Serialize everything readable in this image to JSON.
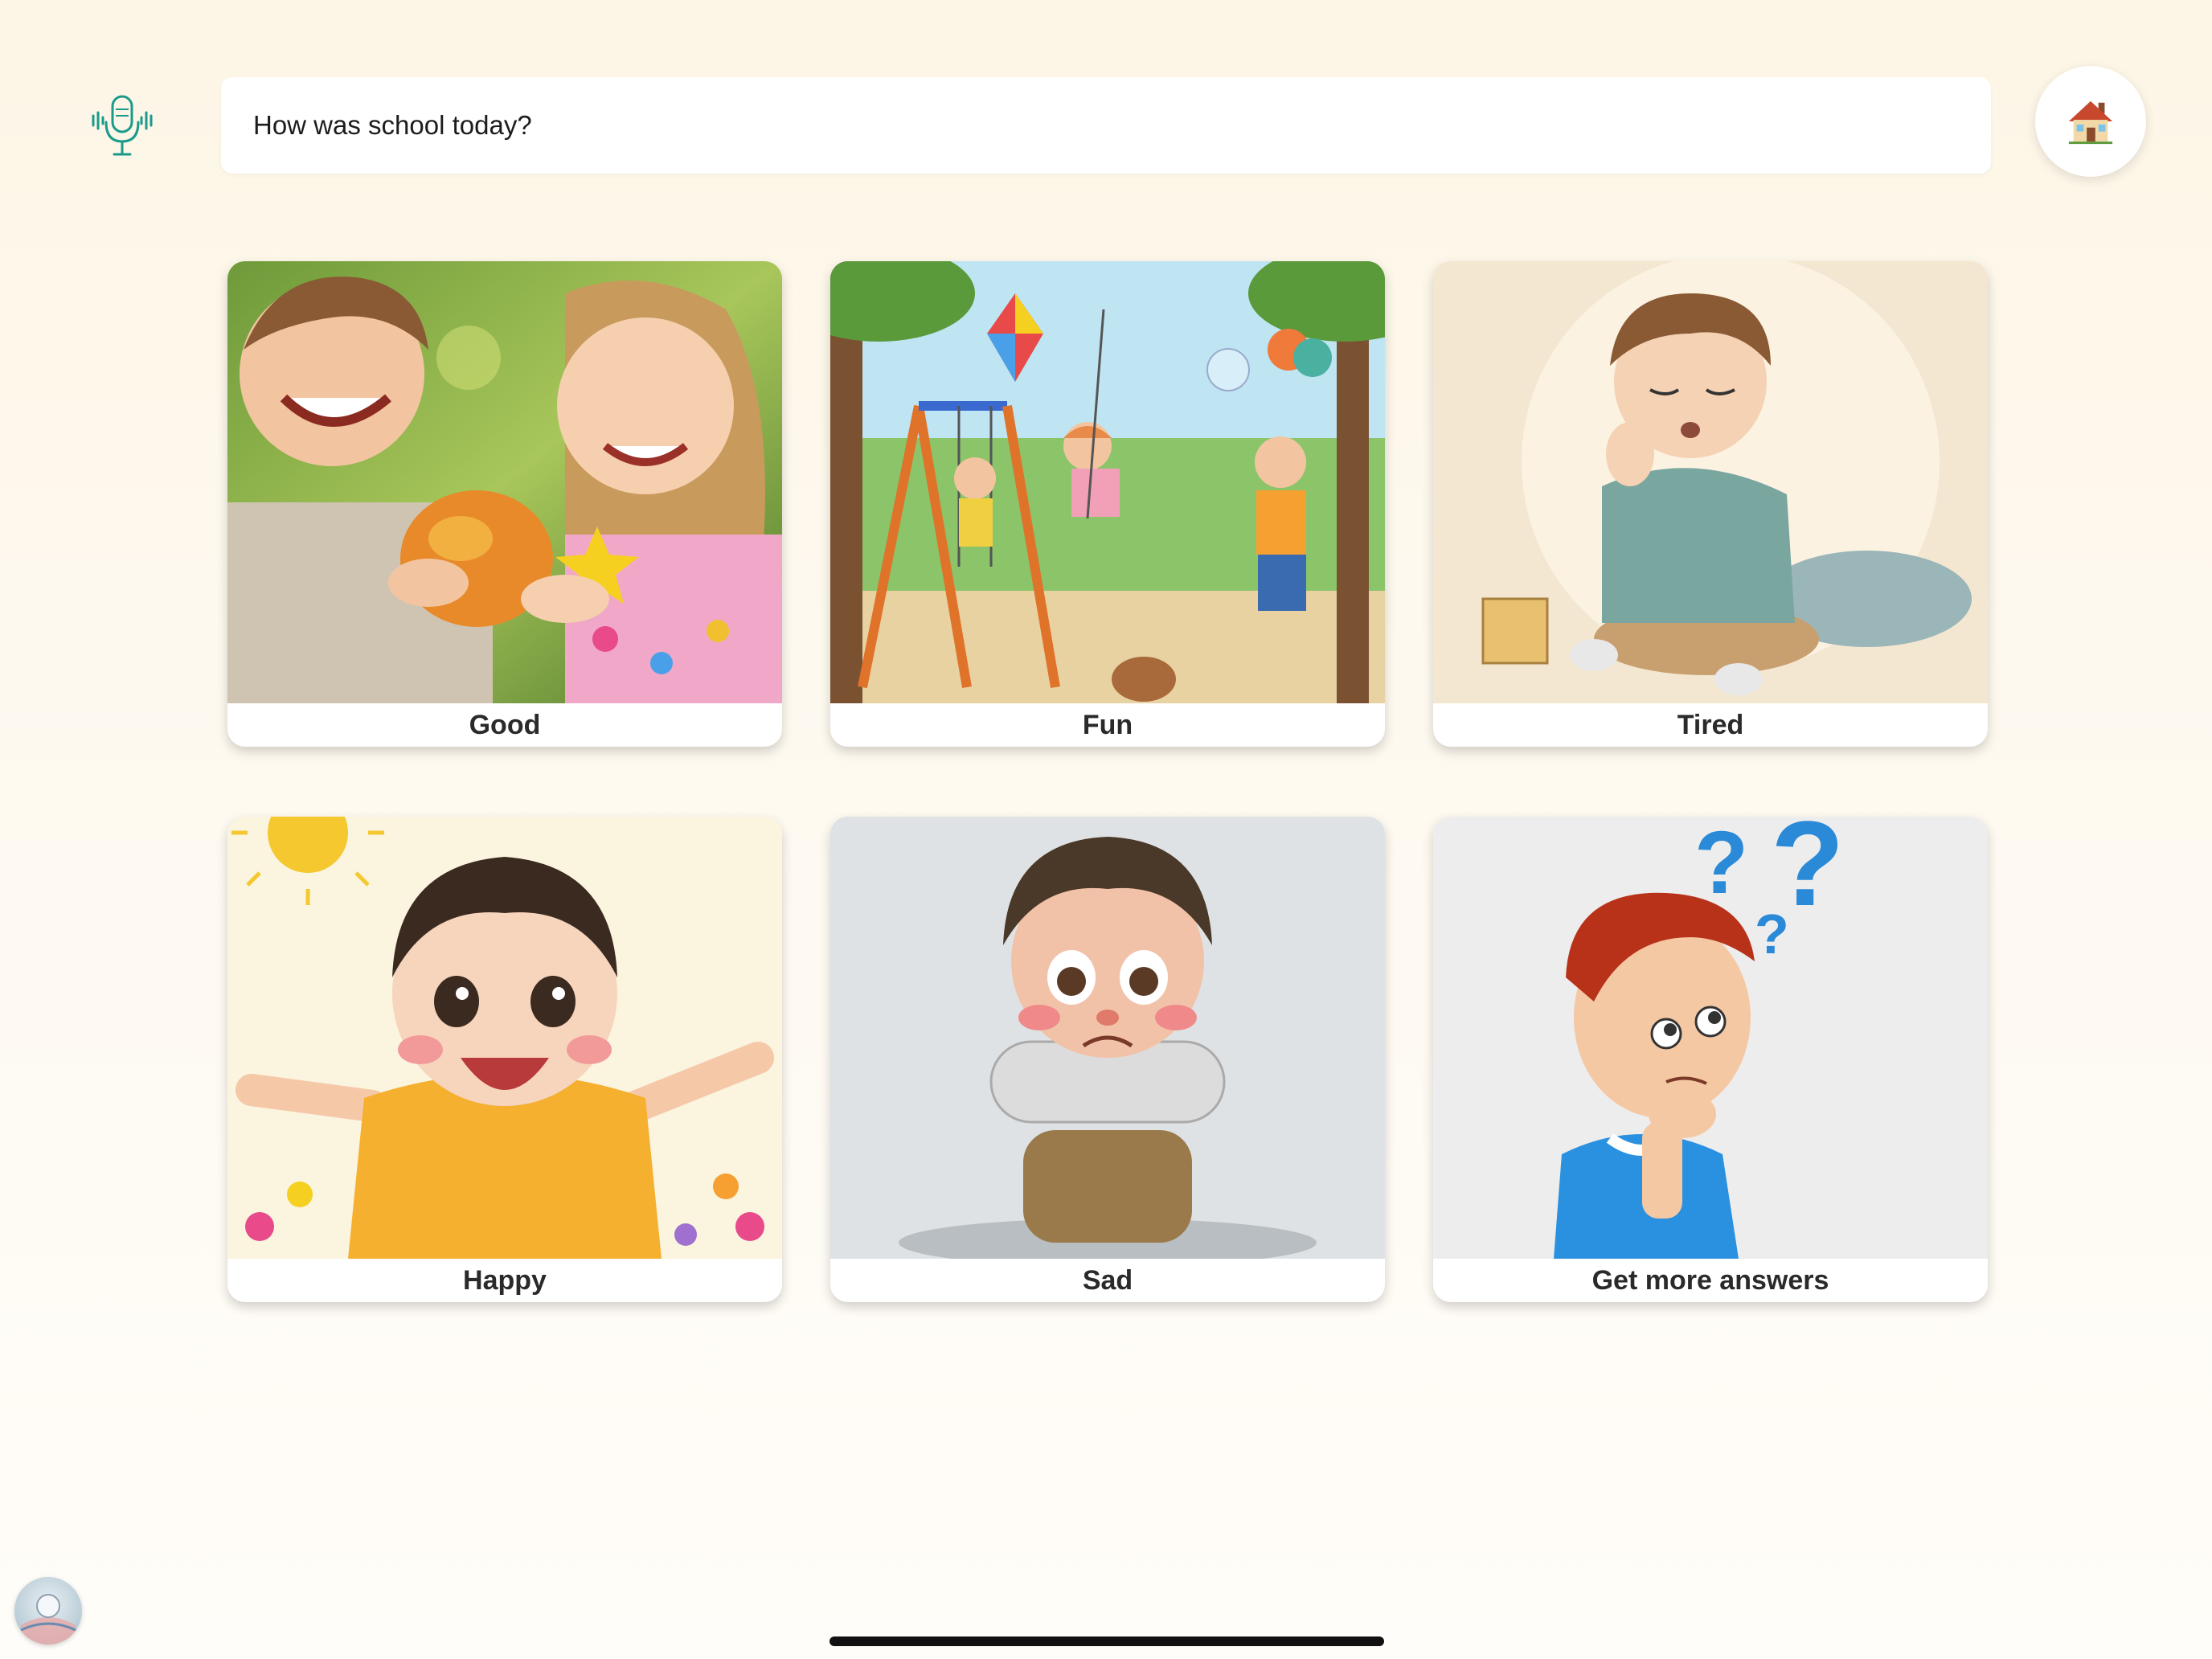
{
  "header": {
    "mic_icon": "microphone-icon",
    "question": "How was school today?",
    "home_icon": "house-icon"
  },
  "cards": [
    {
      "label": "Good",
      "image": "children-sharing-apple"
    },
    {
      "label": "Fun",
      "image": "kids-playing-on-swings"
    },
    {
      "label": "Tired",
      "image": "tired-boy-with-pillow"
    },
    {
      "label": "Happy",
      "image": "happy-child-arms-open"
    },
    {
      "label": "Sad",
      "image": "sad-boy-hugging-knees"
    },
    {
      "label": "Get more answers",
      "image": "thinking-boy-question-marks"
    }
  ],
  "colors": {
    "background": "#fdf6e6",
    "mic_accent": "#1a9a8a",
    "card_label": "#2a2a2a"
  }
}
